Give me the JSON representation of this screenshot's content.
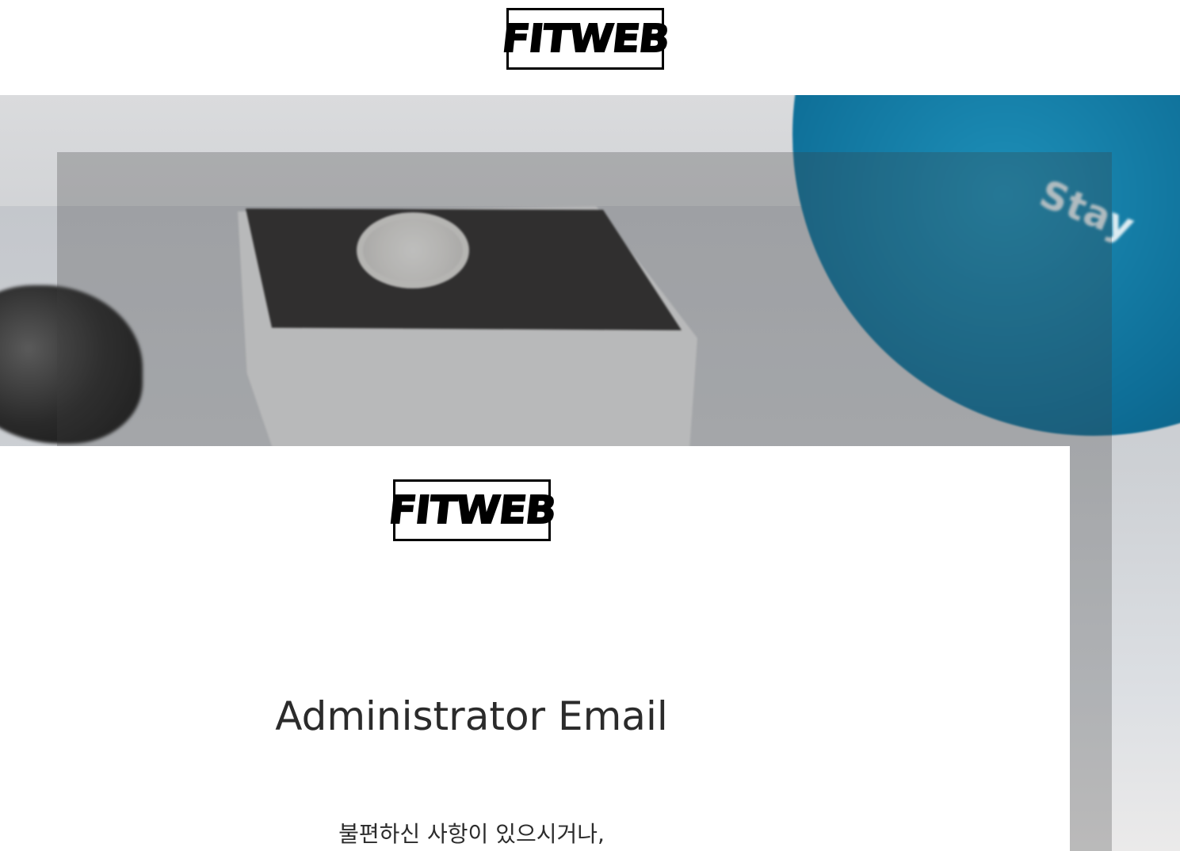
{
  "header": {
    "logo_text": "FITWEB"
  },
  "hero": {
    "ball_text": "Stay"
  },
  "card": {
    "logo_text": "FITWEB",
    "title": "Administrator Email",
    "message_line": "불편하신 사항이 있으시거나,"
  },
  "colors": {
    "ball": "#0e6e97",
    "text": "#2b2b2b",
    "logo_border": "#000000"
  }
}
